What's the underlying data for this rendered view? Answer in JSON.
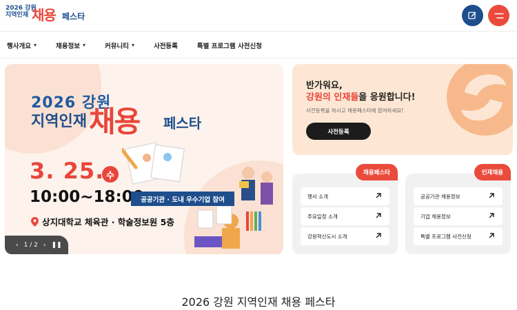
{
  "header": {
    "logo_small": "2026 강원 지역인재",
    "logo_big": "채용",
    "logo_suffix": "페스타",
    "edit_icon": "edit-icon",
    "menu_icon": "hamburger-icon"
  },
  "nav": {
    "items": [
      {
        "label": "행사개요",
        "dropdown": true
      },
      {
        "label": "채용정보",
        "dropdown": true
      },
      {
        "label": "커뮤니티",
        "dropdown": true
      },
      {
        "label": "사전등록",
        "dropdown": false
      },
      {
        "label": "특별 프로그램 사전신청",
        "dropdown": false
      }
    ]
  },
  "banner": {
    "year_line": "2026 강원",
    "line2": "지역인재",
    "big_word": "채용",
    "fest": "페스타",
    "date": "3. 25.",
    "day": "수",
    "time": "10:00~18:00",
    "tag": "공공기관 · 도내 우수기업 참여",
    "place": "상지대학교 체육관 · 학술정보원 5층",
    "pager": "1 / 2"
  },
  "welcome": {
    "greeting": "반가워요,",
    "line_accent": "강원의 인재들",
    "line_rest": "을 응원합니다!",
    "description": "사전등록을 하시고 채용페스타에 참여하세요!",
    "button": "사전등록"
  },
  "card_festa": {
    "tag": "채용페스타",
    "links": [
      "행사 소개",
      "주요일정 소개",
      "강원혁신도시 소개"
    ]
  },
  "card_jobs": {
    "tag": "인재채용",
    "links": [
      "공공기관 채용정보",
      "기업 채용정보",
      "특별 프로그램 사전신청"
    ]
  },
  "page_title": "2026 강원 지역인재 채용 페스타",
  "colors": {
    "accent_red": "#e8463a",
    "brand_blue": "#1e4e8c",
    "welcome_bg": "#fde7d4"
  }
}
